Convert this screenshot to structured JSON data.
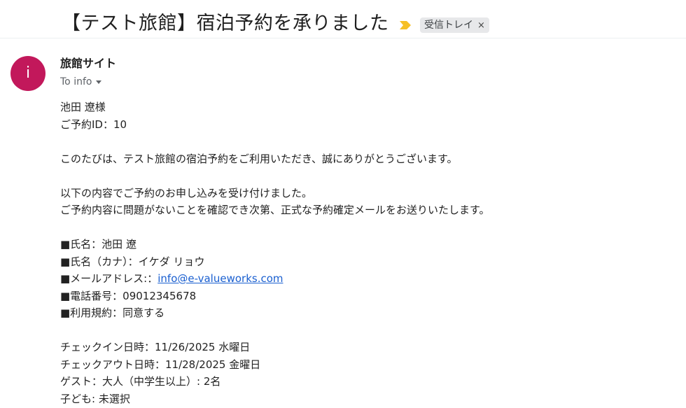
{
  "email": {
    "subject": "【テスト旅館】宿泊予約を承りました",
    "label": "受信トレイ",
    "label_close": "×",
    "important_icon": "importance-marker-icon",
    "avatar_letter": "i",
    "sender": "旅館サイト",
    "recipient": "To info",
    "body": {
      "line1": "池田 遼様",
      "line2": "ご予約ID：10",
      "line3": "このたびは、テスト旅館の宿泊予約をご利用いただき、誠にありがとうございます。",
      "line4": "以下の内容でご予約のお申し込みを受け付けました。",
      "line5": "ご予約内容に問題がないことを確認でき次第、正式な予約確定メールをお送りいたします。",
      "name_line": "■氏名：池田 遼",
      "kana_line": "■氏名（カナ）：イケダ リョウ",
      "email_prefix": "■メールアドレス:：",
      "email_link": "info@e-valueworks.com",
      "phone_line": "■電話番号：09012345678",
      "terms_line": "■利用規約：同意する",
      "checkin_line": "チェックイン日時：11/26/2025 水曜日",
      "checkout_line": "チェックアウト日時：11/28/2025 金曜日",
      "guest_line": "ゲスト：大人（中学生以上）: 2名",
      "children_line": "子ども: 未選択"
    }
  },
  "colors": {
    "avatar": "#c2185b",
    "important": "#f6c026",
    "link": "#1a5fd0"
  }
}
